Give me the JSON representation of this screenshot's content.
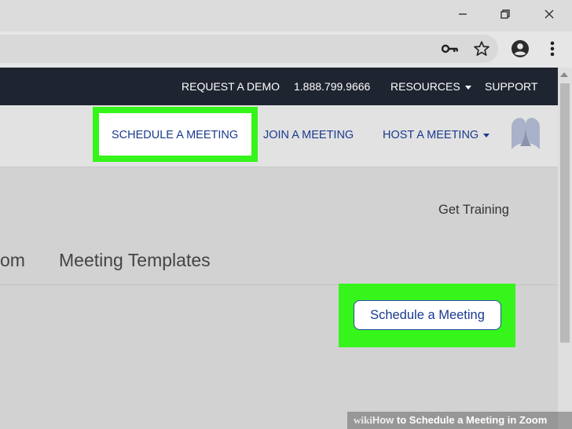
{
  "browser": {
    "window_controls": {
      "minimize_icon": "minimize-icon",
      "restore_icon": "restore-icon",
      "close_icon": "close-icon"
    },
    "toolbar_icons": [
      "key-icon",
      "star-icon",
      "account-icon",
      "more-vert-icon"
    ]
  },
  "top_nav": {
    "request_demo": "REQUEST A DEMO",
    "phone": "1.888.799.9666",
    "resources": "RESOURCES",
    "support": "SUPPORT"
  },
  "secondary_nav": {
    "schedule": "SCHEDULE A MEETING",
    "join": "JOIN A MEETING",
    "host": "HOST A MEETING"
  },
  "content": {
    "get_training": "Get Training",
    "tabs": [
      {
        "label": "om"
      },
      {
        "label": "Meeting Templates"
      }
    ],
    "schedule_button": "Schedule a Meeting"
  },
  "watermark": {
    "wiki": "wiki",
    "how": "How",
    "title": " to Schedule a Meeting in Zoom"
  },
  "colors": {
    "highlight": "#35f51a",
    "nav_dark": "#1f2431",
    "link_blue": "#1a3a8f"
  }
}
